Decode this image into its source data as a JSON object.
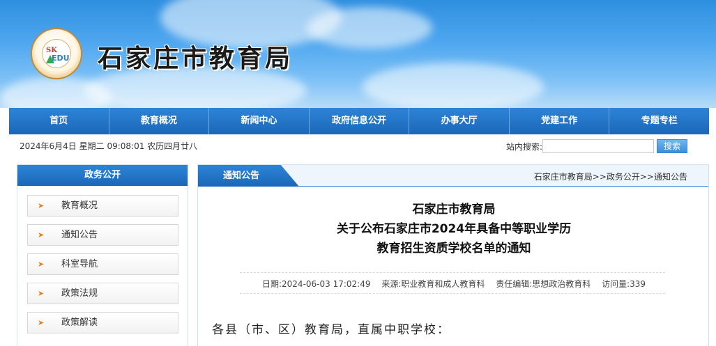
{
  "site": {
    "title": "石家庄市教育局",
    "logo_letters_top": "SK",
    "logo_letters_bottom": "EDU",
    "logo_ring_text": "石家庄市教育局"
  },
  "nav": {
    "items": [
      "首页",
      "教育概况",
      "新闻中心",
      "政府信息公开",
      "办事大厅",
      "党建工作",
      "专题专栏"
    ]
  },
  "infobar": {
    "date": "2024年6月4日 星期二 09:08:01 农历四月廿八",
    "search_label": "站内搜索:",
    "search_value": "",
    "search_button": "搜索"
  },
  "sidebar": {
    "title": "政务公开",
    "items": [
      "教育概况",
      "通知公告",
      "科室导航",
      "政策法规",
      "政策解读"
    ]
  },
  "main": {
    "tab": "通知公告",
    "breadcrumb": "石家庄市教育局>>政务公开>>通知公告",
    "article": {
      "title_lines": [
        "石家庄市教育局",
        "关于公布石家庄市2024年具备中等职业学历",
        "教育招生资质学校名单的通知"
      ],
      "date": "日期:2024-06-03 17:02:49",
      "source": "来源:职业教育和成人教育科",
      "editor": "责任编辑:思想政治教育科",
      "views": "访问量:339",
      "salutation": "各县（市、区）教育局，直属中职学校："
    }
  },
  "colors": {
    "nav_blue": "#1b67b9",
    "accent_orange": "#e67e22"
  }
}
